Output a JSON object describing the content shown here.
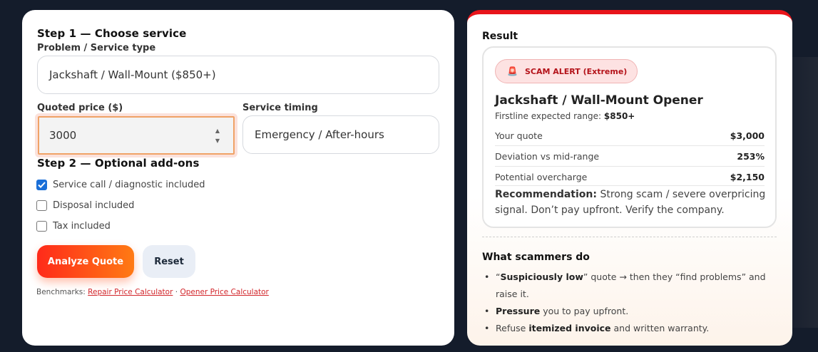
{
  "form": {
    "step1_title": "Step 1 — Choose service",
    "service_label": "Problem / Service type",
    "service_value": "Jackshaft / Wall-Mount ($850+)",
    "price_label": "Quoted price ($)",
    "price_value": "3000",
    "timing_label": "Service timing",
    "timing_value": "Emergency / After-hours",
    "step2_title": "Step 2 — Optional add-ons",
    "addons": [
      {
        "label": "Service call / diagnostic included",
        "checked": true
      },
      {
        "label": "Disposal included",
        "checked": false
      },
      {
        "label": "Tax included",
        "checked": false
      }
    ],
    "analyze_label": "Analyze Quote",
    "reset_label": "Reset",
    "benchmarks_prefix": "Benchmarks:",
    "benchmark_link1": "Repair Price Calculator",
    "benchmark_sep": "·",
    "benchmark_link2": "Opener Price Calculator"
  },
  "result": {
    "heading": "Result",
    "alert_icon": "siren-icon",
    "alert_label": "SCAM ALERT (Extreme)",
    "title": "Jackshaft / Wall-Mount Opener",
    "range_prefix": "Firstline expected range:",
    "range_value": "$850+",
    "rows": [
      {
        "key": "Your quote",
        "value": "$3,000"
      },
      {
        "key": "Deviation vs mid-range",
        "value": "253%"
      },
      {
        "key": "Potential overcharge",
        "value": "$2,150"
      }
    ],
    "recommend_label": "Recommendation:",
    "recommend_text": "Strong scam / severe overpricing signal. Don’t pay upfront. Verify the company."
  },
  "scammers": {
    "title": "What scammers do",
    "items": [
      {
        "pre": "“",
        "bold": "Suspiciously low",
        "post": "” quote → then they “find problems” and raise it."
      },
      {
        "pre": "",
        "bold": "Pressure",
        "post": " you to pay upfront."
      },
      {
        "pre": "Refuse ",
        "bold": "itemized invoice",
        "post": " and written warranty."
      }
    ]
  },
  "colors": {
    "background": "#141c2b",
    "accent_red": "#e8141a",
    "button_gradient_start": "#ff2a1a",
    "button_gradient_end": "#ff7a14",
    "checkbox_blue": "#1a6fd8",
    "alert_text": "#b4131a"
  }
}
